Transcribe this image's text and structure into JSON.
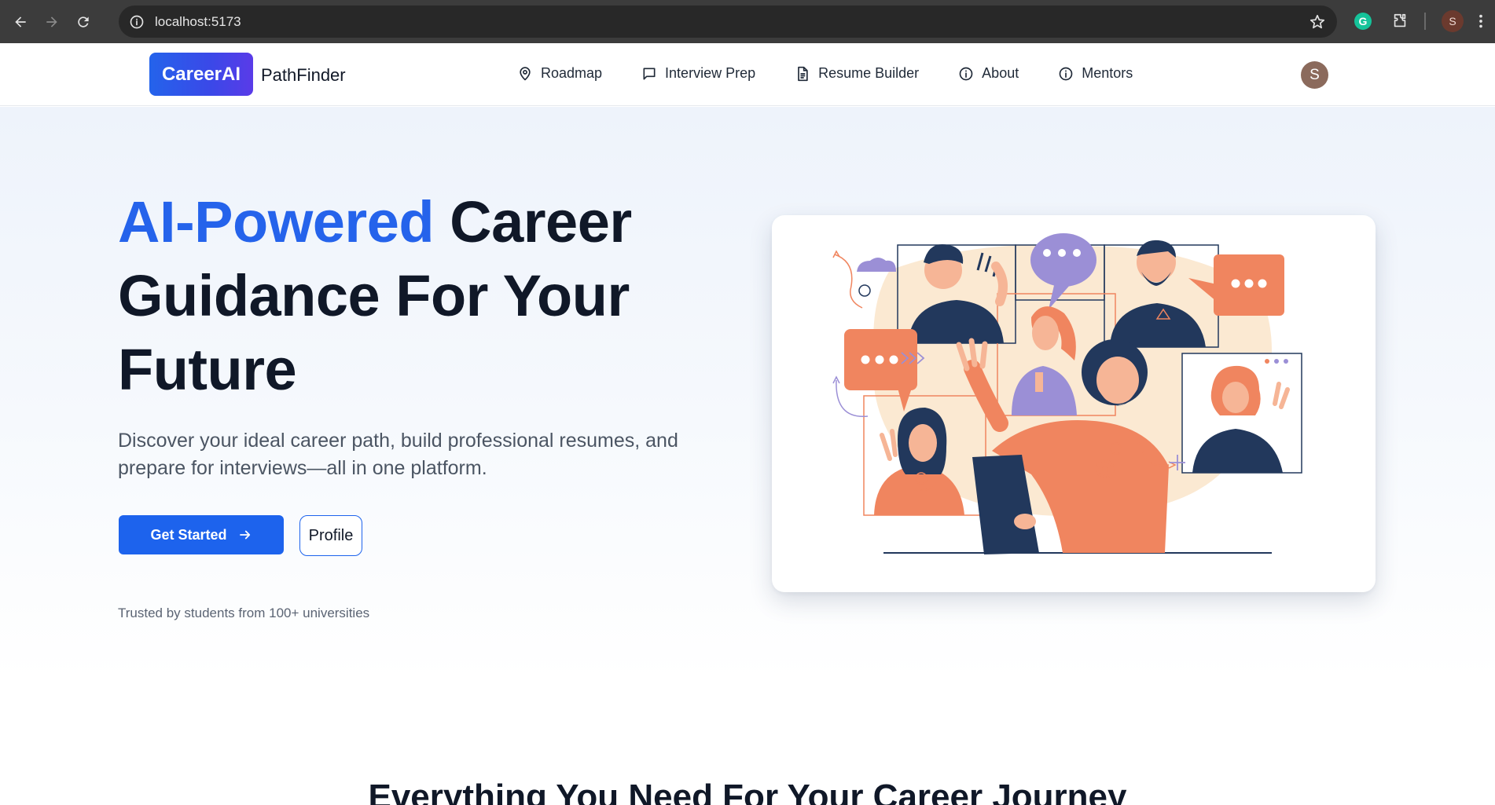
{
  "browser": {
    "url": "localhost:5173",
    "profile_initial": "S"
  },
  "header": {
    "logo_badge": "CareerAI",
    "logo_text": "PathFinder",
    "nav": [
      {
        "label": "Roadmap",
        "icon": "map-pin-icon"
      },
      {
        "label": "Interview Prep",
        "icon": "message-square-icon"
      },
      {
        "label": "Resume Builder",
        "icon": "file-text-icon"
      },
      {
        "label": "About",
        "icon": "info-icon"
      },
      {
        "label": "Mentors",
        "icon": "info-icon"
      }
    ],
    "user_initial": "S"
  },
  "hero": {
    "headline_accent": "AI-Powered",
    "headline_rest": "Career Guidance For Your Future",
    "subtext": "Discover your ideal career path, build professional resumes, and prepare for interviews—all in one platform.",
    "primary_button": "Get Started",
    "secondary_button": "Profile",
    "trusted_text": "Trusted by students from 100+ universities"
  },
  "features": {
    "title": "Everything You Need For Your Career Journey"
  },
  "colors": {
    "accent": "#2563eb",
    "illustration_orange": "#f0855f",
    "illustration_navy": "#22385c",
    "illustration_purple": "#9b8fd6",
    "illustration_cream": "#fbe9d2"
  }
}
